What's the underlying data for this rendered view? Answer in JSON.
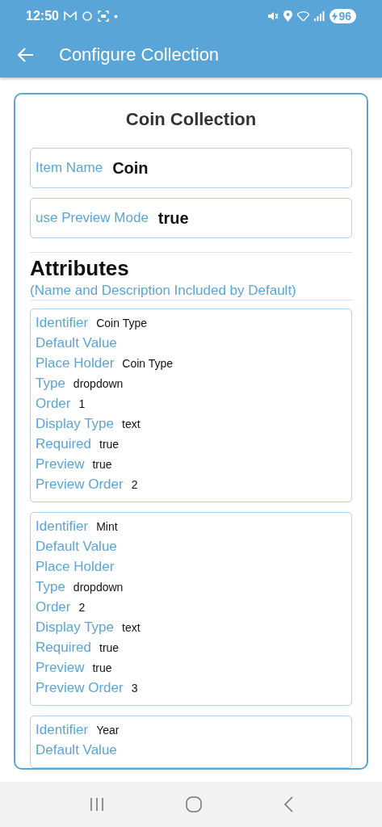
{
  "status_bar": {
    "time": "12:50",
    "battery": "96"
  },
  "app_bar": {
    "title": "Configure Collection"
  },
  "collection": {
    "title": "Coin Collection",
    "fields": [
      {
        "label": "Item Name",
        "value": "Coin"
      },
      {
        "label": "use Preview Mode",
        "value": "true"
      }
    ],
    "attributes_heading": "Attributes",
    "attributes_note": "(Name and Description Included by Default)",
    "attributes": [
      {
        "rows": [
          {
            "label": "Identifier",
            "value": "Coin Type"
          },
          {
            "label": "Default Value"
          },
          {
            "label": "Place Holder",
            "value": "Coin Type"
          },
          {
            "label": "Type",
            "value": "dropdown"
          },
          {
            "label": "Order",
            "value": "1"
          },
          {
            "label": "Display Type",
            "value": "text"
          },
          {
            "label": "Required",
            "value": "true"
          },
          {
            "label": "Preview",
            "value": "true"
          },
          {
            "label": "Preview Order",
            "value": "2"
          }
        ]
      },
      {
        "rows": [
          {
            "label": "Identifier",
            "value": "Mint"
          },
          {
            "label": "Default Value"
          },
          {
            "label": "Place Holder"
          },
          {
            "label": "Type",
            "value": "dropdown"
          },
          {
            "label": "Order",
            "value": "2"
          },
          {
            "label": "Display Type",
            "value": "text"
          },
          {
            "label": "Required",
            "value": "true"
          },
          {
            "label": "Preview",
            "value": "true"
          },
          {
            "label": "Preview Order",
            "value": "3"
          }
        ]
      },
      {
        "rows": [
          {
            "label": "Identifier",
            "value": "Year"
          },
          {
            "label": "Default Value"
          }
        ]
      }
    ]
  }
}
